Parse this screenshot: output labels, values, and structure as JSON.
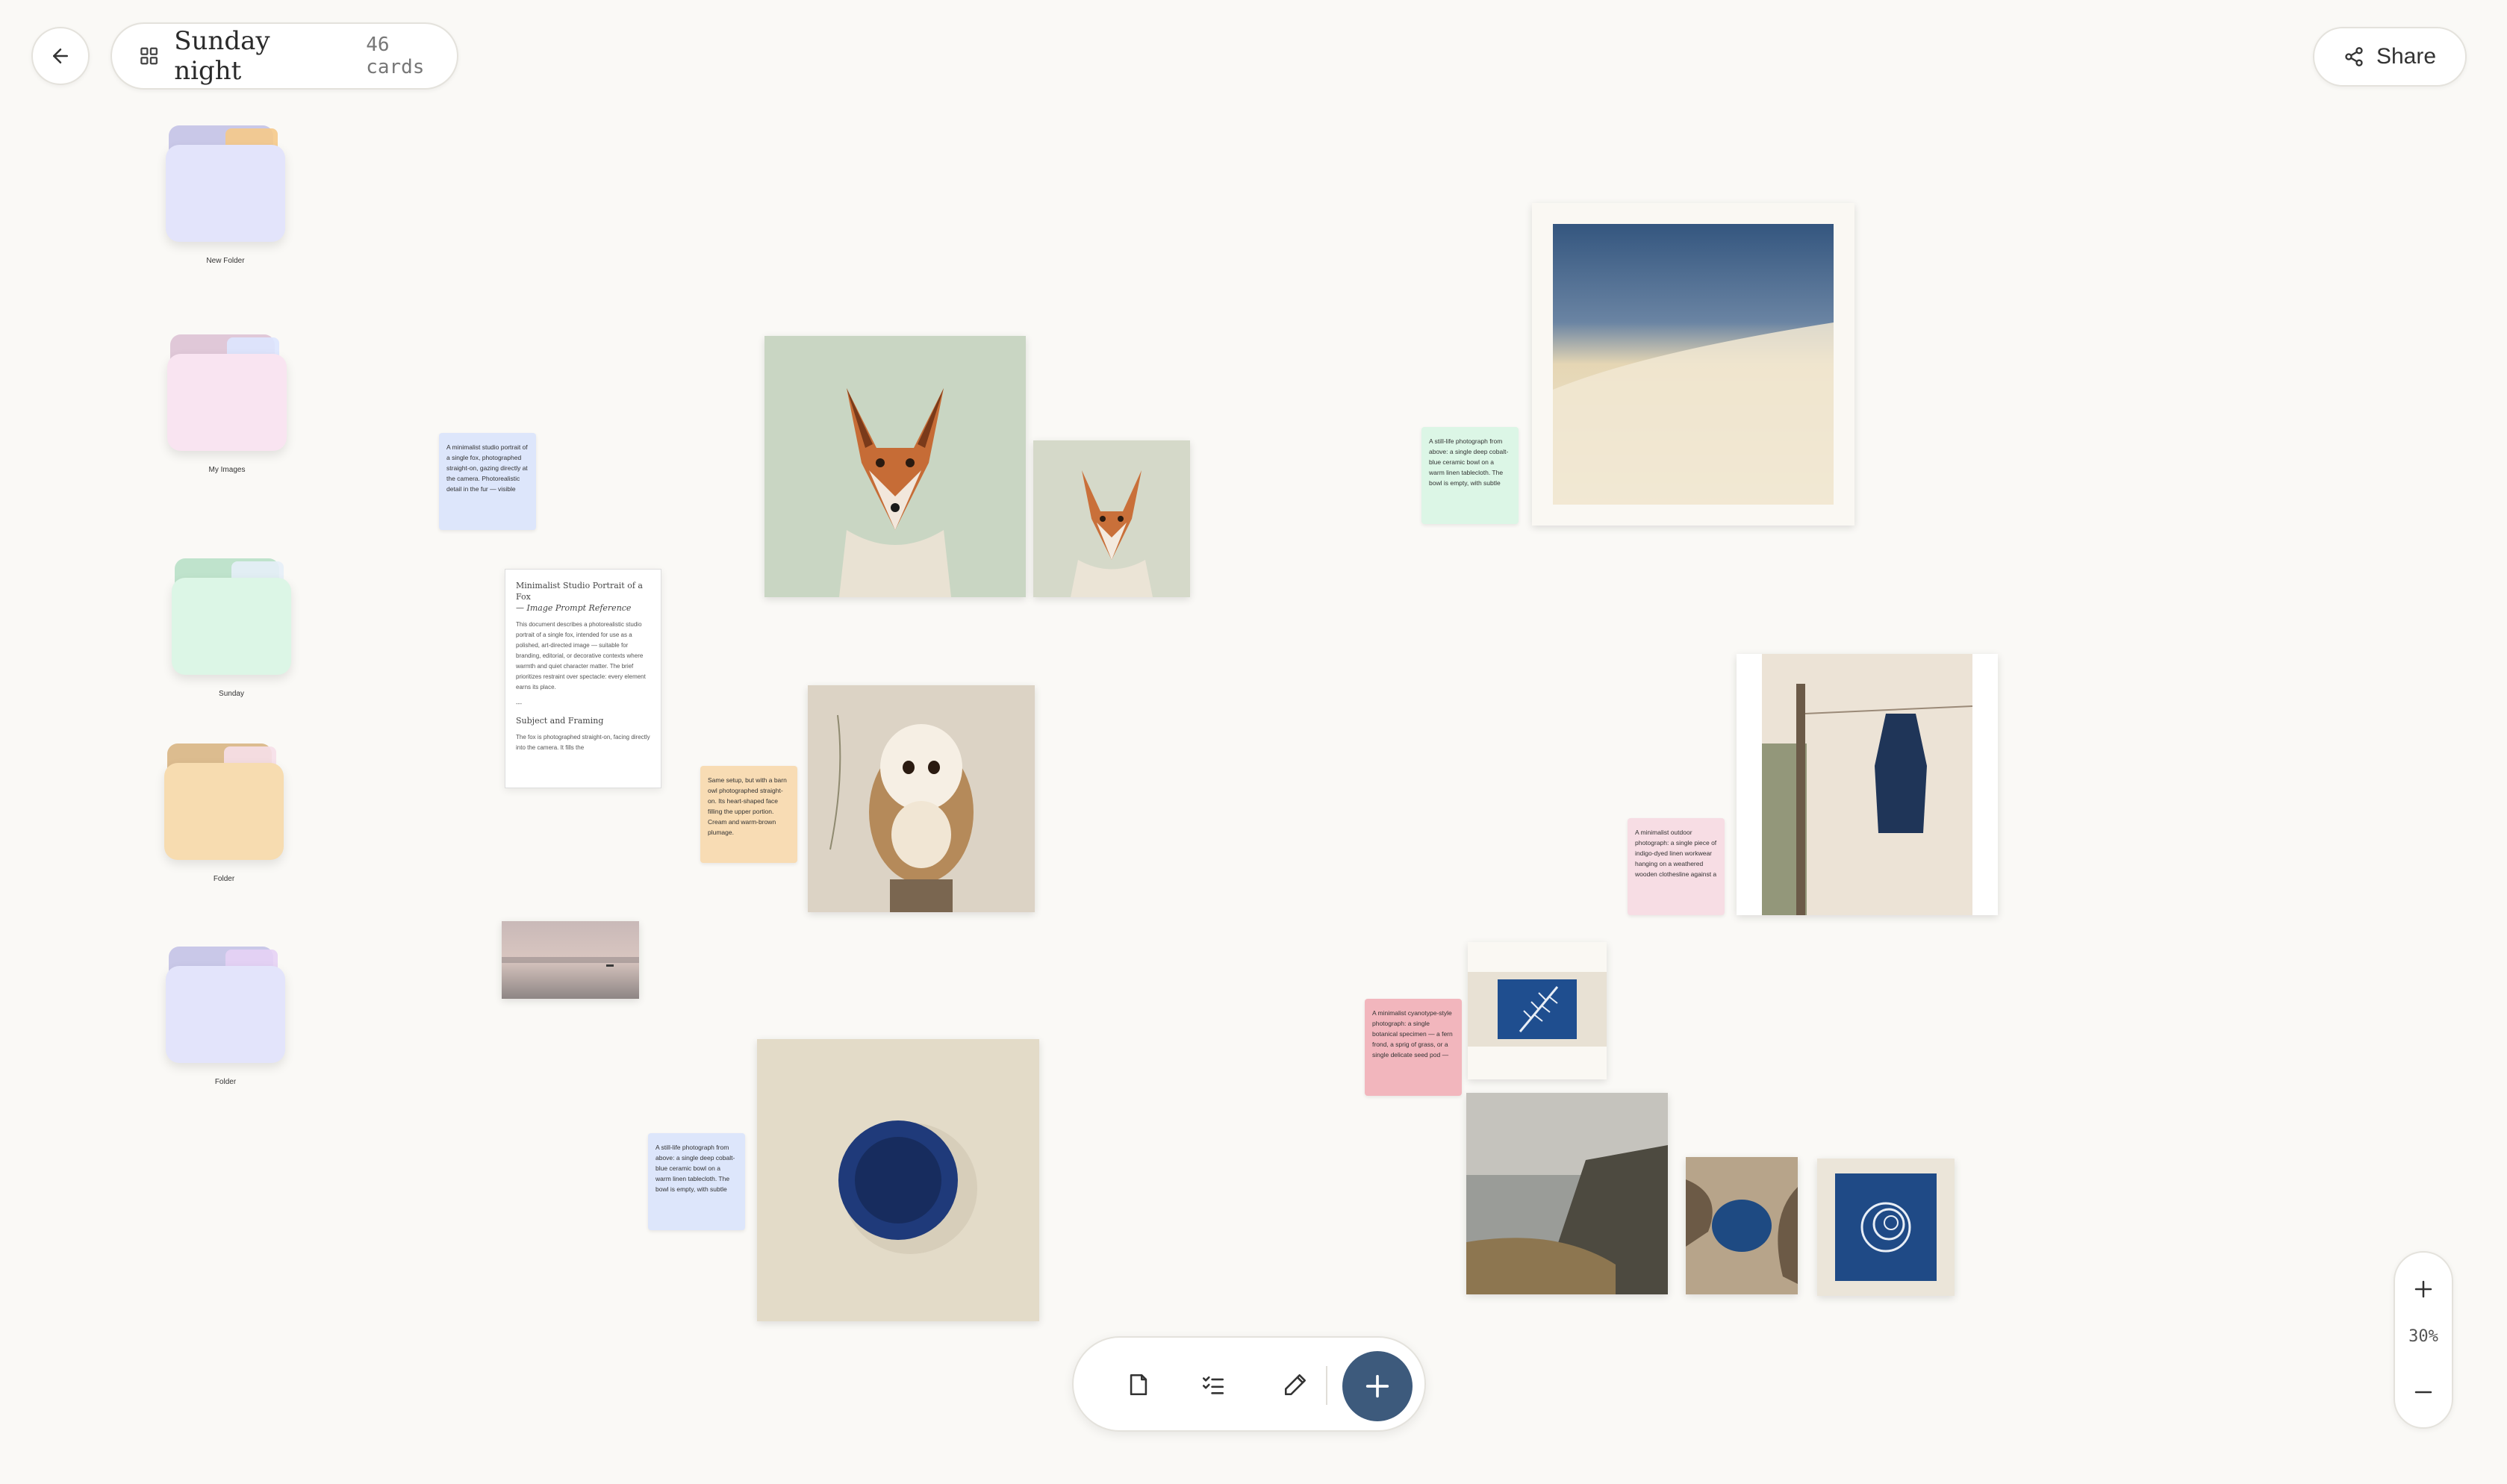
{
  "header": {
    "title": "Sunday night",
    "card_count": "46 cards",
    "share_label": "Share"
  },
  "folders": [
    {
      "label": "New Folder",
      "color": "#e3e4fb"
    },
    {
      "label": "My Images",
      "color": "#f9e4f1"
    },
    {
      "label": "Sunday",
      "color": "#dcf6e6"
    },
    {
      "label": "Folder",
      "color": "#f7dcb0"
    },
    {
      "label": "Folder",
      "color": "#e3e4fb"
    }
  ],
  "notes": {
    "fox_note": "A minimalist studio portrait of a single fox, photographed straight-on, gazing directly at the camera. Photorealistic detail in the fur — visible",
    "owl_note": "Same setup, but with a barn owl photographed straight-on. Its heart-shaped face filling the upper portion. Cream and warm-brown plumage.",
    "bowl_note_blue": "A still-life photograph from above: a single deep cobalt-blue ceramic bowl on a warm linen tablecloth. The bowl is empty, with subtle",
    "bowl_note_green": "A still-life photograph from above: a single deep cobalt-blue ceramic bowl on a warm linen tablecloth. The bowl is empty, with subtle",
    "jacket_note": "A minimalist outdoor photograph: a single piece of indigo-dyed linen workwear hanging on a weathered wooden clothesline against a",
    "cyanotype_note": "A minimalist cyanotype-style photograph: a single botanical specimen — a fern frond, a sprig of grass, or a single delicate seed pod —"
  },
  "document": {
    "title": "Minimalist Studio Portrait of a Fox",
    "subtitle": "— Image Prompt Reference",
    "body": "This document describes a photorealistic studio portrait of a single fox, intended for use as a polished, art-directed image — suitable for branding, editorial, or decorative contexts where warmth and quiet character matter. The brief prioritizes restraint over spectacle: every element earns its place.",
    "divider": "---",
    "section_heading": "Subject and Framing",
    "section_body": "The fox is photographed straight-on, facing directly into the camera. It fills the"
  },
  "toolbar": {
    "note_tool": "note-icon",
    "checklist_tool": "checklist-icon",
    "draw_tool": "pencil-icon",
    "add": "plus-icon"
  },
  "zoom": {
    "level": "30%"
  },
  "colors": {
    "accent": "#3d5a7c",
    "background": "#faf9f6"
  }
}
